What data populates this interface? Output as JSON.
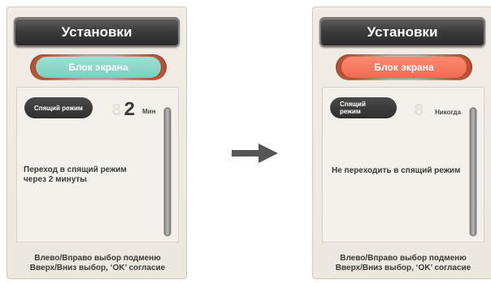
{
  "screens": [
    {
      "title": "Установки",
      "tab_label": "Блок экрана",
      "mode_label": "Спящий режим",
      "digit_ghost": "8",
      "digit_value": "2",
      "unit": "Мин",
      "description_line1": "Переход в спящий режим",
      "description_line2": "через 2 минуты",
      "hint_line1": "Влево/Вправо выбор подменю",
      "hint_line2": "Вверх/Вниз выбор, ‘OK’ согласие",
      "pill_color": "#7ccfbe"
    },
    {
      "title": "Установки",
      "tab_label": "Блок экрана",
      "mode_label": "Спящий режим",
      "digit_ghost": "8",
      "unit": "Никогда",
      "description_line1": "Не переходить в спящий режим",
      "hint_line1": "Влево/Вправо выбор подменю",
      "hint_line2": "Вверх/Вниз выбор, ‘OK’ согласие",
      "pill_color": "#ef6a52"
    }
  ],
  "arrow_icon": "right-arrow-icon",
  "colors": {
    "header_dark": "#2b2b2b",
    "accent_teal": "#7ccfbe",
    "accent_red": "#ef6a52",
    "panel_bg": "#ece7df"
  }
}
